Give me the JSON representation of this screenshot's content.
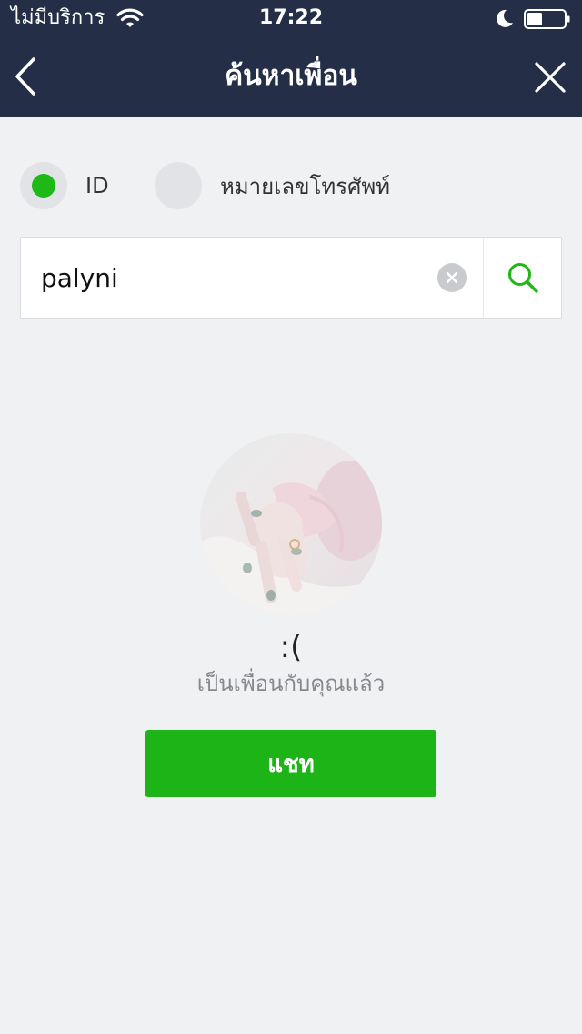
{
  "status_bar": {
    "carrier": "ไม่มีบริการ",
    "time": "17:22",
    "icons": [
      "wifi-icon",
      "moon-icon",
      "battery-icon"
    ]
  },
  "nav": {
    "title": "ค้นหาเพื่อน",
    "back_icon": "chevron-left-icon",
    "close_icon": "close-icon"
  },
  "search_type": {
    "options": [
      {
        "label": "ID",
        "selected": true
      },
      {
        "label": "หมายเลขโทรศัพท์",
        "selected": false
      }
    ]
  },
  "search": {
    "value": "palyni",
    "clear_icon": "clear-icon",
    "search_icon": "search-icon"
  },
  "result": {
    "avatar": "profile-photo",
    "name": ":(",
    "status": "เป็นเพื่อนกับคุณแล้ว",
    "chat_label": "แชท"
  },
  "colors": {
    "header_bg": "#242f47",
    "accent_green": "#1fb917",
    "page_bg": "#f0f1f3"
  }
}
